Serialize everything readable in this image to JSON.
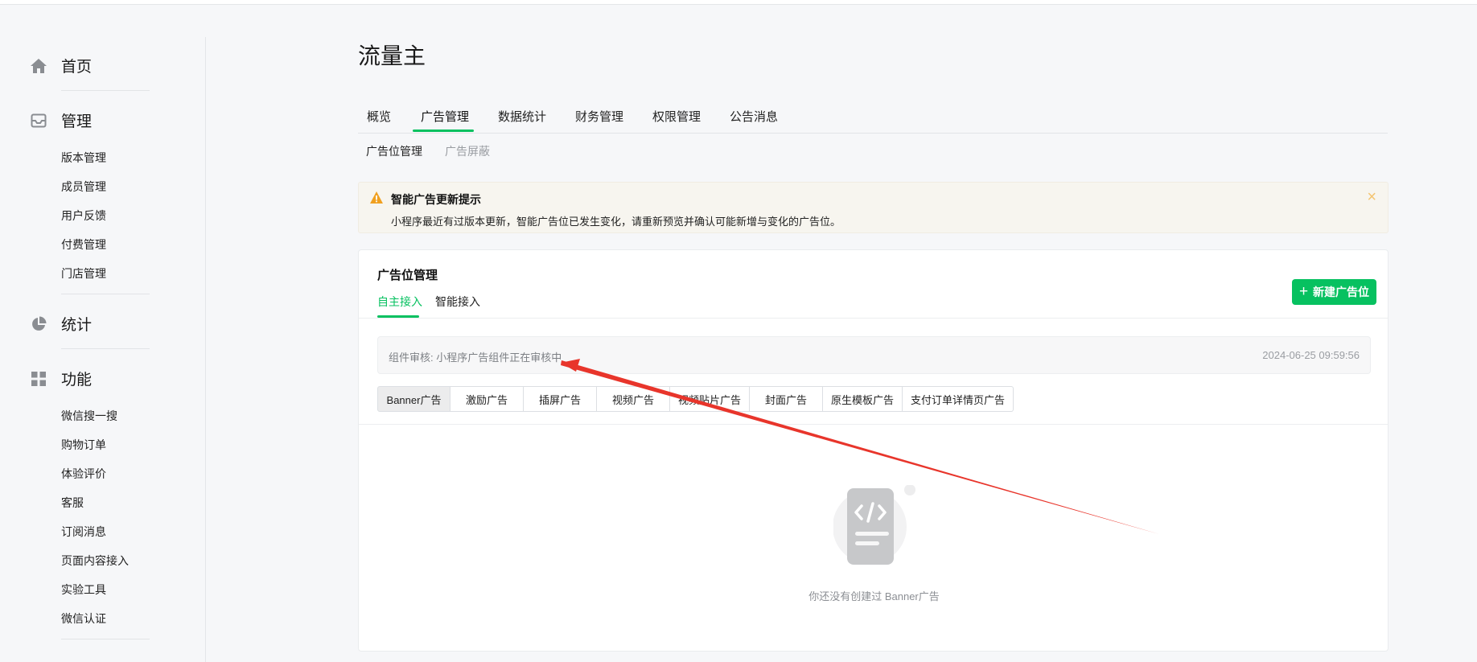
{
  "sidebar": {
    "sections": [
      {
        "label": "首页",
        "icon": "home-icon"
      },
      {
        "label": "管理",
        "icon": "inbox-icon"
      },
      {
        "label": "统计",
        "icon": "pie-chart-icon"
      },
      {
        "label": "功能",
        "icon": "grid-icon"
      }
    ],
    "manage_items": [
      "版本管理",
      "成员管理",
      "用户反馈",
      "付费管理",
      "门店管理"
    ],
    "feature_items": [
      "微信搜一搜",
      "购物订单",
      "体验评价",
      "客服",
      "订阅消息",
      "页面内容接入",
      "实验工具",
      "微信认证"
    ]
  },
  "page_title": "流量主",
  "tabs": [
    "概览",
    "广告管理",
    "数据统计",
    "财务管理",
    "权限管理",
    "公告消息"
  ],
  "active_tab": "广告管理",
  "subtabs": [
    "广告位管理",
    "广告屏蔽"
  ],
  "notice": {
    "title": "智能广告更新提示",
    "text": "小程序最近有过版本更新，智能广告位已发生变化，请重新预览并确认可能新增与变化的广告位。",
    "close": "×"
  },
  "card": {
    "title": "广告位管理",
    "tabs": [
      "自主接入",
      "智能接入"
    ],
    "new_button": "新建广告位",
    "new_button_icon": "+",
    "review_text": "组件审核: 小程序广告组件正在审核中",
    "review_time": "2024-06-25 09:59:56",
    "ad_types": [
      "Banner广告",
      "激励广告",
      "插屏广告",
      "视频广告",
      "视频贴片广告",
      "封面广告",
      "原生模板广告",
      "支付订单详情页广告"
    ],
    "empty_text": "你还没有创建过 Banner广告"
  },
  "colors": {
    "accent": "#07c160",
    "annotation_arrow": "#e8352b",
    "warning": "#f0a020"
  }
}
